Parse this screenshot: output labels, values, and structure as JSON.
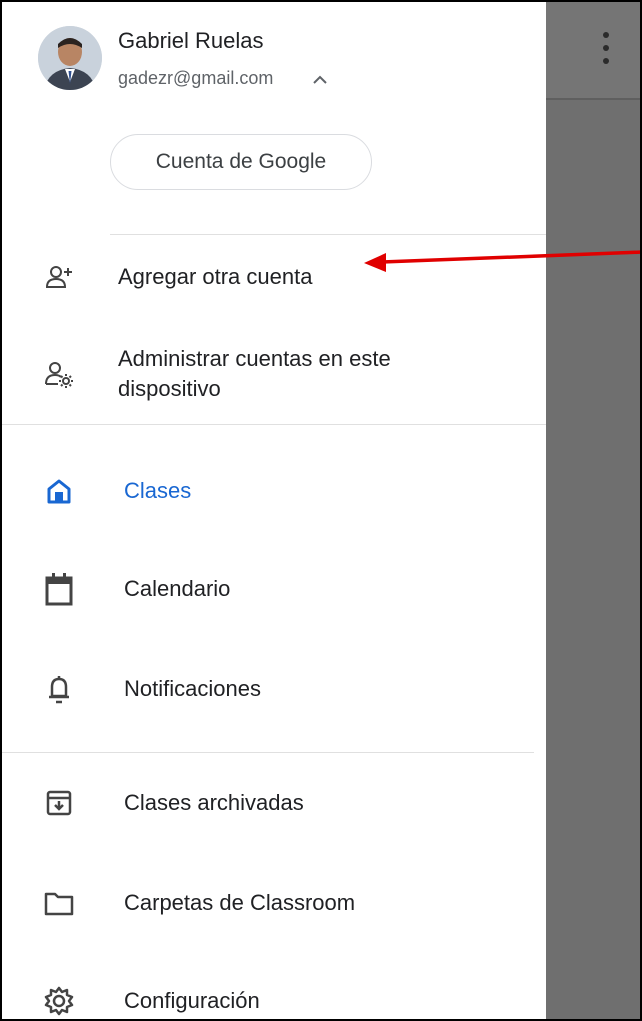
{
  "account": {
    "name": "Gabriel Ruelas",
    "email": "gadezr@gmail.com",
    "manage_button": "Cuenta de Google"
  },
  "account_actions": [
    {
      "label": "Agregar otra cuenta",
      "icon": "add-person-icon"
    },
    {
      "label": "Administrar cuentas en este dispositivo",
      "icon": "manage-accounts-icon"
    }
  ],
  "nav": [
    {
      "label": "Clases",
      "icon": "home-icon",
      "active": true
    },
    {
      "label": "Calendario",
      "icon": "calendar-icon"
    },
    {
      "label": "Notificaciones",
      "icon": "bell-icon"
    }
  ],
  "nav_secondary": [
    {
      "label": "Clases archivadas",
      "icon": "archive-icon"
    },
    {
      "label": "Carpetas de Classroom",
      "icon": "folder-icon"
    },
    {
      "label": "Configuración",
      "icon": "gear-icon"
    }
  ],
  "colors": {
    "active": "#1967d2",
    "scrim": "#6f6f6f",
    "annotation_arrow": "#e00000"
  }
}
